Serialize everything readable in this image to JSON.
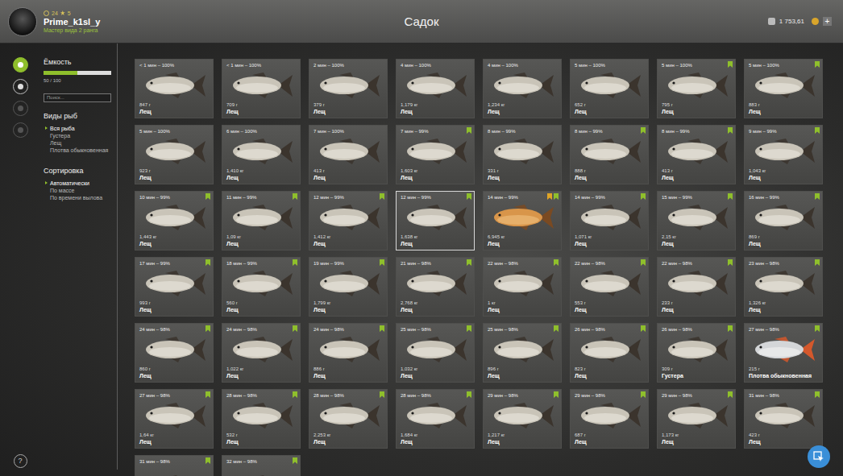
{
  "window": {
    "title": "Садок"
  },
  "player": {
    "name": "Prime_k1sl_y",
    "level": "24",
    "rank": "5",
    "subtitle": "Мастер вида 2 ранга"
  },
  "wallet": {
    "silver": "1 753,61",
    "add": "+"
  },
  "rail": [
    {
      "selected": true,
      "disabled": false
    },
    {
      "selected": false,
      "disabled": false
    },
    {
      "selected": false,
      "disabled": true
    },
    {
      "selected": false,
      "disabled": true
    }
  ],
  "capacity": {
    "title": "Ёмкость",
    "level": 0.5,
    "reading": "50 / 100"
  },
  "search": {
    "placeholder": "Поиск..."
  },
  "filters": {
    "title": "Виды рыб",
    "items": [
      {
        "label": "Вся рыба",
        "selected": true
      },
      {
        "label": "Густера",
        "selected": false
      },
      {
        "label": "Лещ",
        "selected": false
      },
      {
        "label": "Плотва обыкновенная",
        "selected": false
      }
    ]
  },
  "sort": {
    "title": "Сортировка",
    "items": [
      {
        "label": "Автоматически",
        "selected": true
      },
      {
        "label": "По массе",
        "selected": false
      },
      {
        "label": "По времени вылова",
        "selected": false
      }
    ]
  },
  "fish": [
    {
      "label": "< 1 мин – 100%",
      "weight": "847 г",
      "name": "Лещ",
      "kind": "bream",
      "marked": false,
      "trophy": false,
      "selected": false
    },
    {
      "label": "< 1 мин – 100%",
      "weight": "709 г",
      "name": "Лещ",
      "kind": "bream",
      "marked": false,
      "trophy": false,
      "selected": false
    },
    {
      "label": "2 мин – 100%",
      "weight": "379 г",
      "name": "Лещ",
      "kind": "bream",
      "marked": false,
      "trophy": false,
      "selected": false
    },
    {
      "label": "4 мин – 100%",
      "weight": "1,179 кг",
      "name": "Лещ",
      "kind": "bream",
      "marked": false,
      "trophy": false,
      "selected": false
    },
    {
      "label": "4 мин – 100%",
      "weight": "1,234 кг",
      "name": "Лещ",
      "kind": "bream",
      "marked": false,
      "trophy": false,
      "selected": false
    },
    {
      "label": "5 мин – 100%",
      "weight": "652 г",
      "name": "Лещ",
      "kind": "bream",
      "marked": false,
      "trophy": false,
      "selected": false
    },
    {
      "label": "5 мин – 100%",
      "weight": "795 г",
      "name": "Лещ",
      "kind": "bream",
      "marked": true,
      "trophy": false,
      "selected": false
    },
    {
      "label": "5 мин – 100%",
      "weight": "883 г",
      "name": "Лещ",
      "kind": "bream",
      "marked": true,
      "trophy": false,
      "selected": false
    },
    {
      "label": "5 мин – 100%",
      "weight": "923 г",
      "name": "Лещ",
      "kind": "bream",
      "marked": false,
      "trophy": false,
      "selected": false
    },
    {
      "label": "6 мин – 100%",
      "weight": "1,410 кг",
      "name": "Лещ",
      "kind": "bream",
      "marked": false,
      "trophy": false,
      "selected": false
    },
    {
      "label": "7 мин – 100%",
      "weight": "413 г",
      "name": "Лещ",
      "kind": "bream",
      "marked": false,
      "trophy": false,
      "selected": false
    },
    {
      "label": "7 мин – 99%",
      "weight": "1,603 кг",
      "name": "Лещ",
      "kind": "bream",
      "marked": true,
      "trophy": false,
      "selected": false
    },
    {
      "label": "8 мин – 99%",
      "weight": "331 г",
      "name": "Лещ",
      "kind": "bream",
      "marked": false,
      "trophy": false,
      "selected": false
    },
    {
      "label": "8 мин – 99%",
      "weight": "888 г",
      "name": "Лещ",
      "kind": "bream",
      "marked": true,
      "trophy": false,
      "selected": false
    },
    {
      "label": "8 мин – 99%",
      "weight": "413 г",
      "name": "Лещ",
      "kind": "bream",
      "marked": true,
      "trophy": false,
      "selected": false
    },
    {
      "label": "9 мин – 99%",
      "weight": "1,043 кг",
      "name": "Лещ",
      "kind": "bream",
      "marked": true,
      "trophy": false,
      "selected": false
    },
    {
      "label": "10 мин – 99%",
      "weight": "1,443 кг",
      "name": "Лещ",
      "kind": "bream",
      "marked": true,
      "trophy": false,
      "selected": false
    },
    {
      "label": "11 мин – 99%",
      "weight": "1,09 кг",
      "name": "Лещ",
      "kind": "bream",
      "marked": true,
      "trophy": false,
      "selected": false
    },
    {
      "label": "12 мин – 99%",
      "weight": "1,412 кг",
      "name": "Лещ",
      "kind": "bream",
      "marked": true,
      "trophy": false,
      "selected": false
    },
    {
      "label": "12 мин – 99%",
      "weight": "1,638 кг",
      "name": "Лещ",
      "kind": "bream",
      "marked": true,
      "trophy": false,
      "selected": true
    },
    {
      "label": "14 мин – 99%",
      "weight": "6,945 кг",
      "name": "Лещ",
      "kind": "gold",
      "marked": true,
      "trophy": true,
      "selected": false
    },
    {
      "label": "14 мин – 99%",
      "weight": "1,071 кг",
      "name": "Лещ",
      "kind": "bream",
      "marked": true,
      "trophy": false,
      "selected": false
    },
    {
      "label": "15 мин – 99%",
      "weight": "2,15 кг",
      "name": "Лещ",
      "kind": "bream",
      "marked": true,
      "trophy": false,
      "selected": false
    },
    {
      "label": "16 мин – 99%",
      "weight": "869 г",
      "name": "Лещ",
      "kind": "bream",
      "marked": true,
      "trophy": false,
      "selected": false
    },
    {
      "label": "17 мин – 99%",
      "weight": "993 г",
      "name": "Лещ",
      "kind": "bream",
      "marked": true,
      "trophy": false,
      "selected": false
    },
    {
      "label": "18 мин – 99%",
      "weight": "560 г",
      "name": "Лещ",
      "kind": "bream",
      "marked": true,
      "trophy": false,
      "selected": false
    },
    {
      "label": "19 мин – 99%",
      "weight": "1,799 кг",
      "name": "Лещ",
      "kind": "bream",
      "marked": true,
      "trophy": false,
      "selected": false
    },
    {
      "label": "21 мин – 98%",
      "weight": "2,768 кг",
      "name": "Лещ",
      "kind": "bream",
      "marked": true,
      "trophy": false,
      "selected": false
    },
    {
      "label": "22 мин – 98%",
      "weight": "1 кг",
      "name": "Лещ",
      "kind": "bream",
      "marked": true,
      "trophy": false,
      "selected": false
    },
    {
      "label": "22 мин – 98%",
      "weight": "553 г",
      "name": "Лещ",
      "kind": "bream",
      "marked": true,
      "trophy": false,
      "selected": false
    },
    {
      "label": "22 мин – 98%",
      "weight": "233 г",
      "name": "Лещ",
      "kind": "bream",
      "marked": true,
      "trophy": false,
      "selected": false
    },
    {
      "label": "23 мин – 98%",
      "weight": "1,326 кг",
      "name": "Лещ",
      "kind": "bream",
      "marked": true,
      "trophy": false,
      "selected": false
    },
    {
      "label": "24 мин – 98%",
      "weight": "860 г",
      "name": "Лещ",
      "kind": "bream",
      "marked": true,
      "trophy": false,
      "selected": false
    },
    {
      "label": "24 мин – 98%",
      "weight": "1,022 кг",
      "name": "Лещ",
      "kind": "bream",
      "marked": true,
      "trophy": false,
      "selected": false
    },
    {
      "label": "24 мин – 98%",
      "weight": "886 г",
      "name": "Лещ",
      "kind": "bream",
      "marked": true,
      "trophy": false,
      "selected": false
    },
    {
      "label": "25 мин – 98%",
      "weight": "1,032 кг",
      "name": "Лещ",
      "kind": "bream",
      "marked": true,
      "trophy": false,
      "selected": false
    },
    {
      "label": "25 мин – 98%",
      "weight": "896 г",
      "name": "Лещ",
      "kind": "bream",
      "marked": true,
      "trophy": false,
      "selected": false
    },
    {
      "label": "26 мин – 98%",
      "weight": "823 г",
      "name": "Лещ",
      "kind": "bream",
      "marked": true,
      "trophy": false,
      "selected": false
    },
    {
      "label": "26 мин – 98%",
      "weight": "309 г",
      "name": "Густера",
      "kind": "bream",
      "marked": true,
      "trophy": false,
      "selected": false
    },
    {
      "label": "27 мин – 98%",
      "weight": "215 г",
      "name": "Плотва обыкновенная",
      "kind": "roach",
      "marked": true,
      "trophy": false,
      "selected": false
    },
    {
      "label": "27 мин – 98%",
      "weight": "1,64 кг",
      "name": "Лещ",
      "kind": "bream",
      "marked": true,
      "trophy": false,
      "selected": false
    },
    {
      "label": "28 мин – 98%",
      "weight": "532 г",
      "name": "Лещ",
      "kind": "bream",
      "marked": true,
      "trophy": false,
      "selected": false
    },
    {
      "label": "28 мин – 98%",
      "weight": "2,253 кг",
      "name": "Лещ",
      "kind": "bream",
      "marked": true,
      "trophy": false,
      "selected": false
    },
    {
      "label": "28 мин – 98%",
      "weight": "1,684 кг",
      "name": "Лещ",
      "kind": "bream",
      "marked": true,
      "trophy": false,
      "selected": false
    },
    {
      "label": "29 мин – 98%",
      "weight": "1,217 кг",
      "name": "Лещ",
      "kind": "bream",
      "marked": true,
      "trophy": false,
      "selected": false
    },
    {
      "label": "29 мин – 98%",
      "weight": "687 г",
      "name": "Лещ",
      "kind": "bream",
      "marked": true,
      "trophy": false,
      "selected": false
    },
    {
      "label": "29 мин – 98%",
      "weight": "1,173 кг",
      "name": "Лещ",
      "kind": "bream",
      "marked": true,
      "trophy": false,
      "selected": false
    },
    {
      "label": "31 мин – 98%",
      "weight": "423 г",
      "name": "Лещ",
      "kind": "bream",
      "marked": true,
      "trophy": false,
      "selected": false
    },
    {
      "label": "31 мин – 98%",
      "kind": "bream",
      "marked": true,
      "trophy": false,
      "selected": false
    },
    {
      "label": "32 мин – 98%",
      "kind": "bream",
      "marked": true,
      "trophy": false,
      "selected": false
    }
  ],
  "help": "?"
}
